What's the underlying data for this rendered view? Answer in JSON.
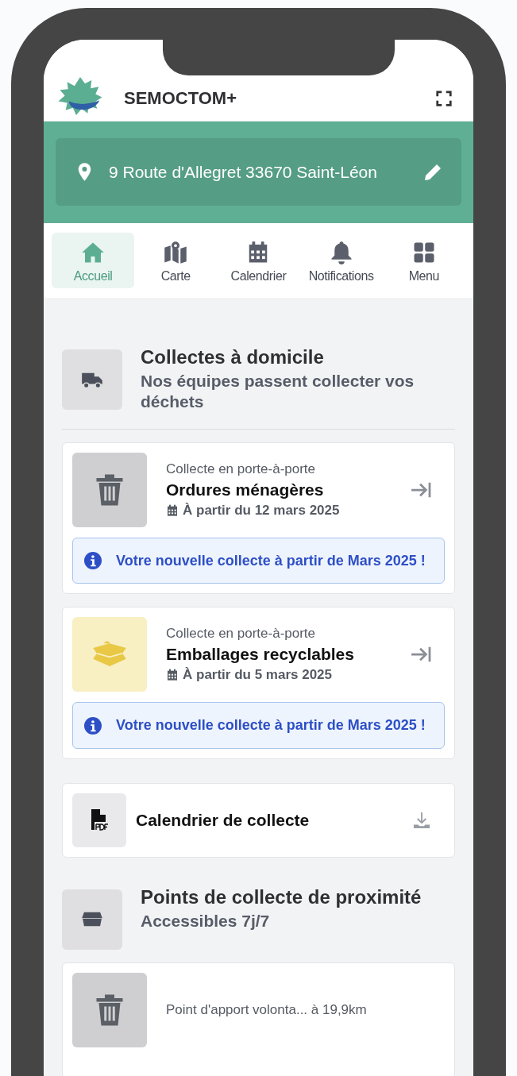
{
  "app": {
    "title": "SEMOCTOM+"
  },
  "address": {
    "text": "9 Route d'Allegret 33670 Saint-Léon"
  },
  "nav": [
    {
      "label": "Accueil",
      "selected": true
    },
    {
      "label": "Carte",
      "selected": false
    },
    {
      "label": "Calendrier",
      "selected": false
    },
    {
      "label": "Notifications",
      "selected": false
    },
    {
      "label": "Menu",
      "selected": false
    }
  ],
  "sections": [
    {
      "title": "Collectes à domicile",
      "subtitle": "Nos équipes passent collecter vos déchets",
      "items": [
        {
          "kind": "collection",
          "color": "#cfcfd1",
          "label": "Collecte en porte-à-porte",
          "title": "Ordures ménagères",
          "date": "À partir du 12 mars 2025",
          "notice": "Votre nouvelle collecte à partir de Mars 2025 !"
        },
        {
          "kind": "collection",
          "color": "#f8efc3",
          "label": "Collecte en porte-à-porte",
          "title": "Emballages recyclables",
          "date": "À partir du 5 mars 2025",
          "notice": "Votre nouvelle collecte à partir de Mars 2025 !"
        },
        {
          "kind": "document",
          "title": "Calendrier de collecte"
        }
      ]
    },
    {
      "title": "Points de collecte de proximité",
      "subtitle": "Accessibles 7j/7",
      "items": [
        {
          "kind": "collection",
          "color": "#cfcfd1",
          "label": "Point d'apport volonta... à 19,9km"
        }
      ]
    }
  ]
}
